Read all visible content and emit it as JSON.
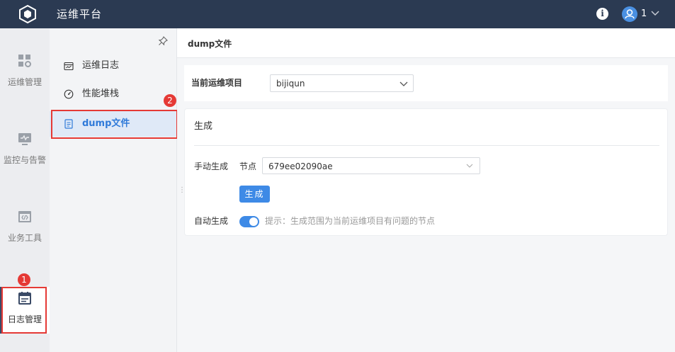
{
  "topbar": {
    "title": "运维平台",
    "info_icon_glyph": "i",
    "user_label": "1",
    "bg_color": "#2b3a52"
  },
  "rail": {
    "items": [
      {
        "label": "运维管理",
        "icon": "apps-grid-icon"
      },
      {
        "label": "监控与告警",
        "icon": "monitor-icon"
      },
      {
        "label": "业务工具",
        "icon": "code-window-icon"
      },
      {
        "label": "日志管理",
        "icon": "calendar-log-icon",
        "active": true
      }
    ],
    "badge": "1"
  },
  "subnav": {
    "items": [
      {
        "label": "运维日志",
        "icon": "calendar-icon"
      },
      {
        "label": "性能堆栈",
        "icon": "gauge-icon"
      },
      {
        "label": "dump文件",
        "icon": "document-icon",
        "active": true
      }
    ],
    "badge": "2",
    "pin_icon": "pin-icon"
  },
  "main": {
    "tab_label": "dump文件",
    "project": {
      "label": "当前运维项目",
      "value": "bijiqun"
    },
    "generate": {
      "title": "生成",
      "manual_label": "手动生成",
      "node_label": "节点",
      "node_value": "679ee02090ae",
      "button_label": "生成",
      "auto_label": "自动生成",
      "auto_enabled": true,
      "hint": "提示：生成范围为当前运维项目有问题的节点"
    }
  },
  "colors": {
    "accent": "#3e8ae6",
    "highlight": "#e53935"
  }
}
